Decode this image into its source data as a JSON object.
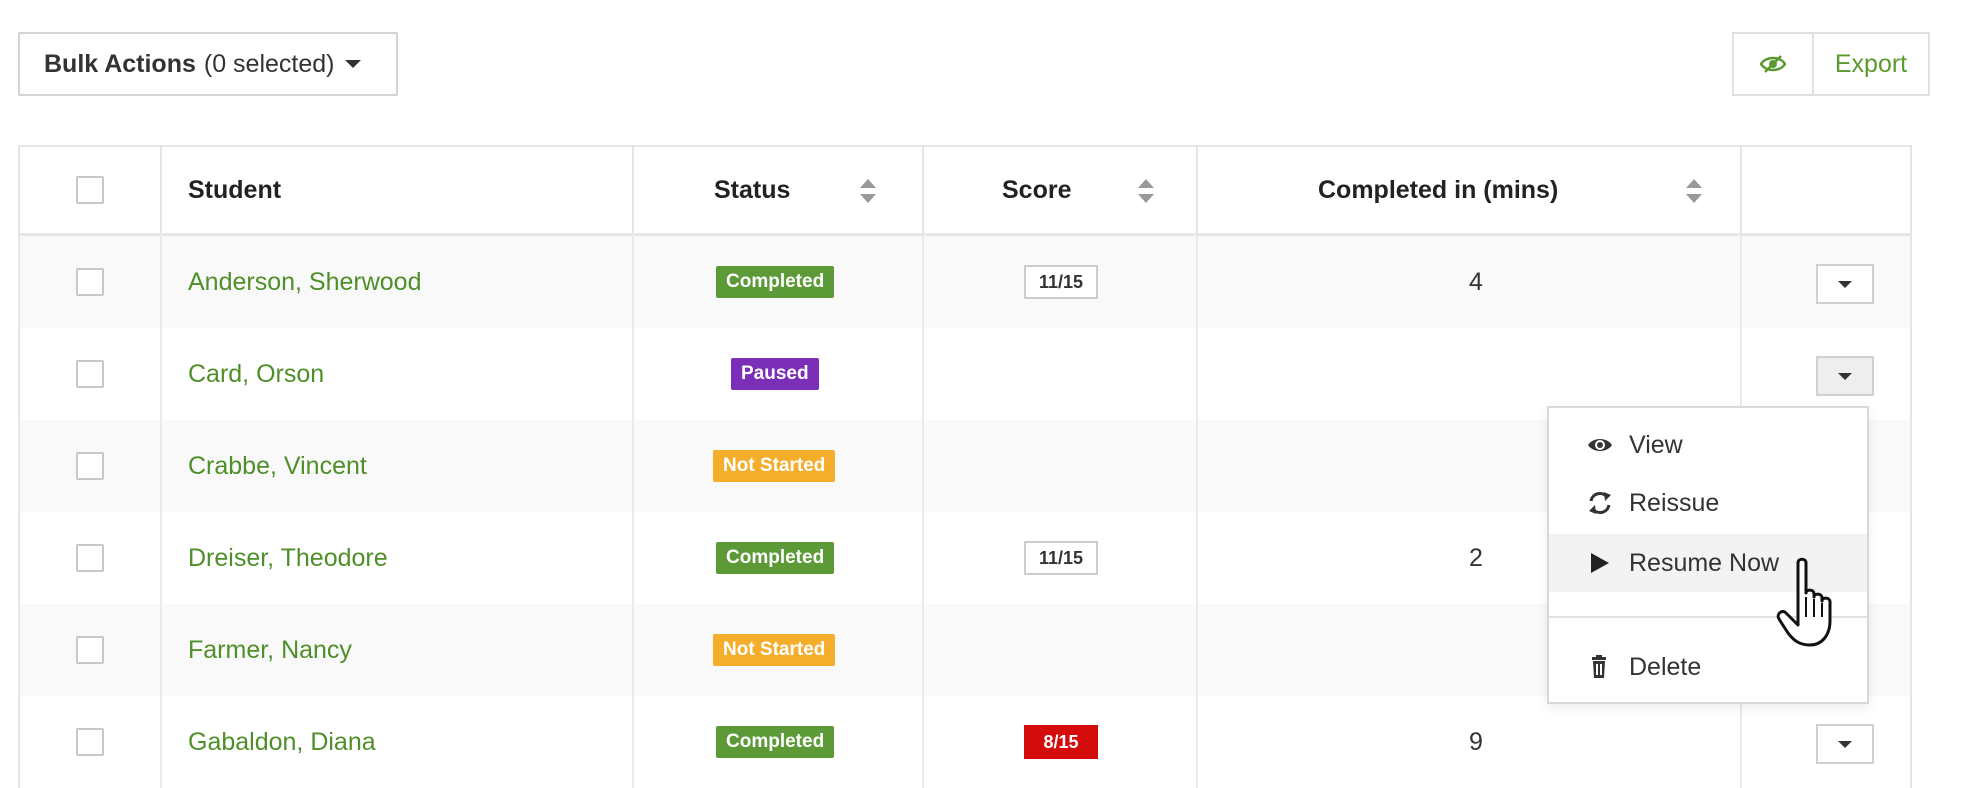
{
  "toolbar": {
    "bulk_label": "Bulk Actions",
    "bulk_count": "(0 selected)",
    "visibility_icon": "eye-slash-icon",
    "export_label": "Export"
  },
  "colors": {
    "green_link": "#4e8f2a",
    "completed": "#5b9a36",
    "paused": "#7b2fb8",
    "not_started": "#f5ad2c",
    "score_low": "#d40c0c"
  },
  "table": {
    "columns": [
      "Student",
      "Status",
      "Score",
      "Completed in (mins)"
    ],
    "rows": [
      {
        "student": "Anderson, Sherwood",
        "status": "Completed",
        "score": "11/15",
        "mins": "4"
      },
      {
        "student": "Card, Orson",
        "status": "Paused",
        "score": "",
        "mins": ""
      },
      {
        "student": "Crabbe, Vincent",
        "status": "Not Started",
        "score": "",
        "mins": ""
      },
      {
        "student": "Dreiser, Theodore",
        "status": "Completed",
        "score": "11/15",
        "mins": "2"
      },
      {
        "student": "Farmer, Nancy",
        "status": "Not Started",
        "score": "",
        "mins": ""
      },
      {
        "student": "Gabaldon, Diana",
        "status": "Completed",
        "score": "8/15",
        "mins": "9"
      }
    ]
  },
  "row_menu": {
    "items": [
      {
        "label": "View",
        "icon": "eye-icon"
      },
      {
        "label": "Reissue",
        "icon": "refresh-icon"
      },
      {
        "label": "Resume Now",
        "icon": "play-icon"
      },
      {
        "label": "Delete",
        "icon": "trash-icon"
      }
    ]
  }
}
